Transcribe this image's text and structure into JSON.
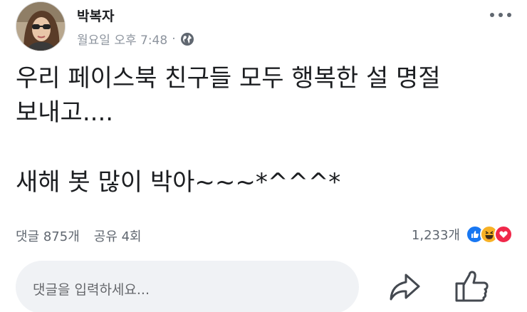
{
  "post": {
    "author": "박복자",
    "timestamp": "월요일 오후 7:48",
    "separator": "·",
    "audience_icon": "globe-icon",
    "menu_icon": "more-horizontal-icon",
    "text_lines": [
      "우리 페이스북 친구들 모두 행복한 설 명절",
      "보내고...."
    ],
    "text_line_2": "새해 봇 많이 박아~~~*^^^*"
  },
  "stats": {
    "comments": "댓글 875개",
    "shares": "공유 4회",
    "reactions_count": "1,233개",
    "reaction_icons": [
      "like-reaction-icon",
      "haha-reaction-icon",
      "love-reaction-icon"
    ]
  },
  "composer": {
    "placeholder": "댓글을 입력하세요...",
    "share_icon": "share-icon",
    "like_icon": "thumbs-up-icon"
  },
  "colors": {
    "like_blue": "#1877f2",
    "haha_yellow": "#f7b125",
    "love_red": "#f0284a",
    "secondary_text": "#606770"
  }
}
